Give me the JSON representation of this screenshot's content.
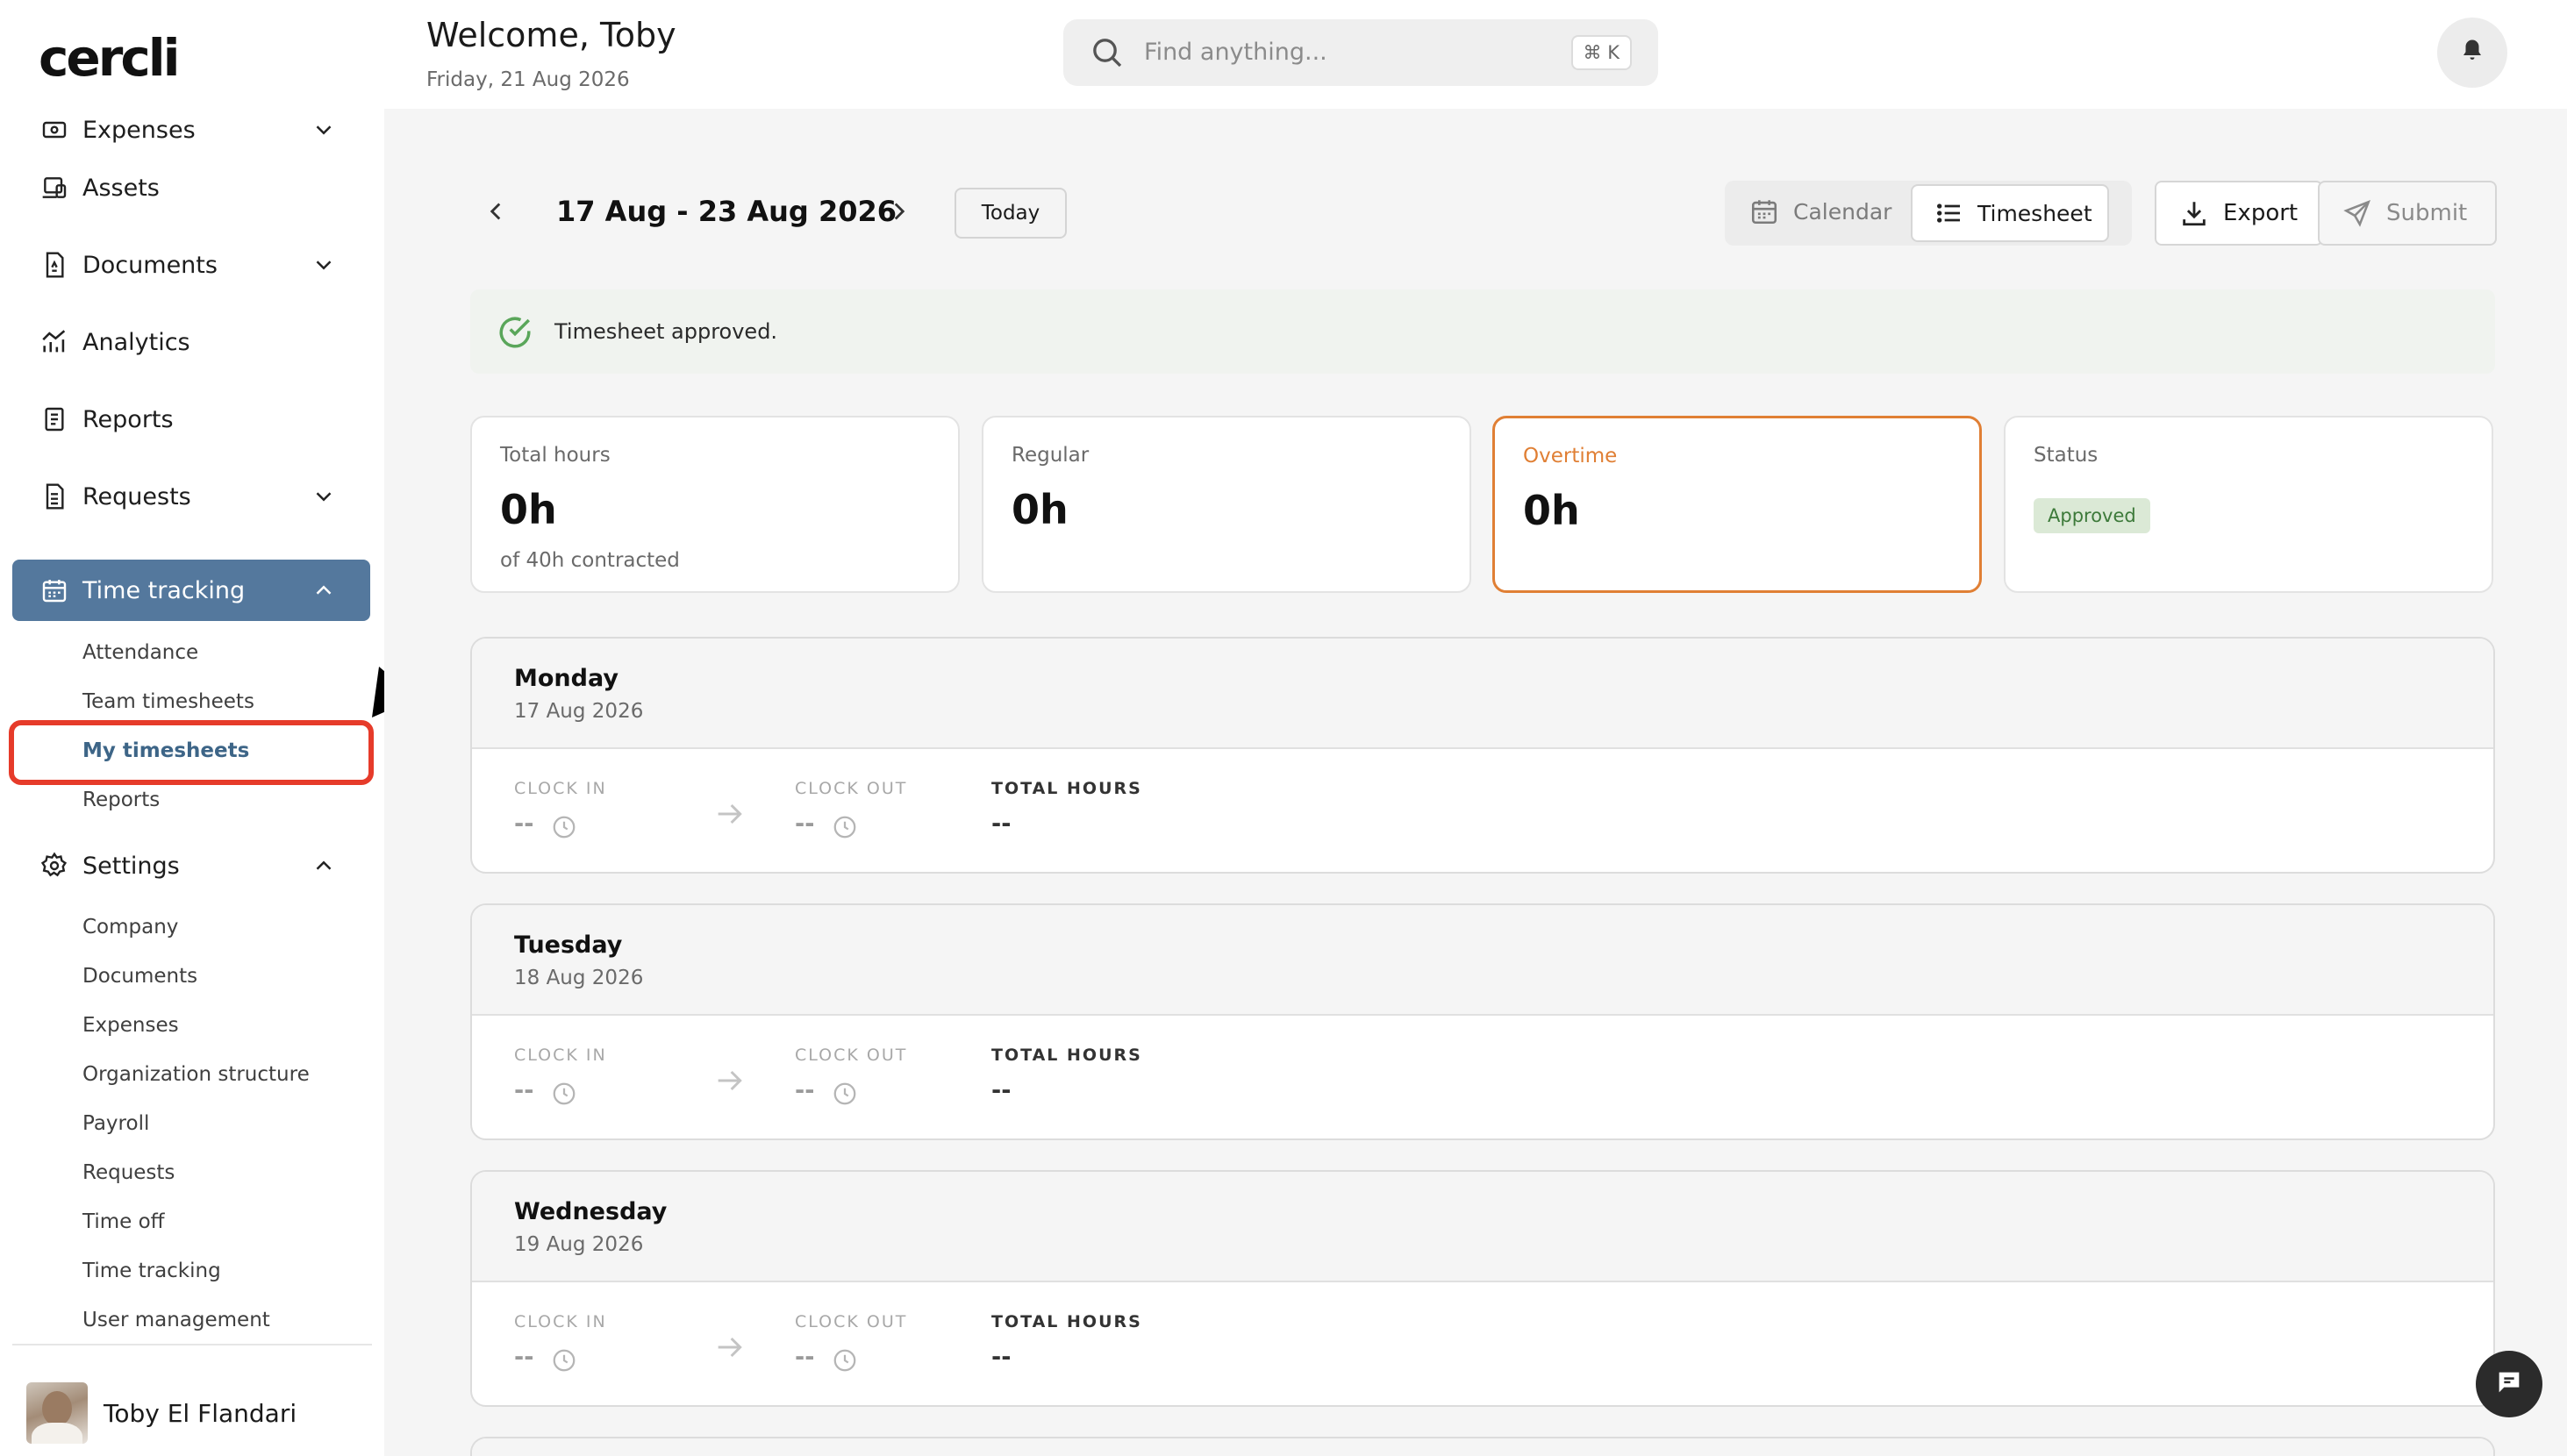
{
  "app": {
    "logo_text": "cercli"
  },
  "header": {
    "welcome": "Welcome, Toby",
    "date": "Friday, 21 Aug 2026",
    "search_placeholder": "Find anything...",
    "search_shortcut": "⌘ K"
  },
  "sidebar": {
    "items": [
      {
        "label": "Expenses",
        "icon": "receipt-icon",
        "expandable": true,
        "expanded": false
      },
      {
        "label": "Assets",
        "icon": "laptop-icon",
        "expandable": false
      },
      {
        "label": "Documents",
        "icon": "document-icon",
        "expandable": true,
        "expanded": false
      },
      {
        "label": "Analytics",
        "icon": "analytics-icon",
        "expandable": false
      },
      {
        "label": "Reports",
        "icon": "report-icon",
        "expandable": false
      },
      {
        "label": "Requests",
        "icon": "requests-icon",
        "expandable": true,
        "expanded": false
      },
      {
        "label": "Time tracking",
        "icon": "calendar-icon",
        "expandable": true,
        "expanded": true,
        "active": true
      },
      {
        "label": "Settings",
        "icon": "gear-icon",
        "expandable": true,
        "expanded": true
      }
    ],
    "time_tracking_sub": [
      "Attendance",
      "Team timesheets",
      "My timesheets",
      "Reports"
    ],
    "time_tracking_selected": "My timesheets",
    "settings_sub": [
      "Company",
      "Documents",
      "Expenses",
      "Organization structure",
      "Payroll",
      "Requests",
      "Time off",
      "Time tracking",
      "User management"
    ],
    "user_name": "Toby El Flandari"
  },
  "toolbar": {
    "week_range": "17 Aug - 23 Aug 2026",
    "today_label": "Today",
    "calendar_label": "Calendar",
    "timesheet_label": "Timesheet",
    "export_label": "Export",
    "submit_label": "Submit"
  },
  "alert": {
    "text": "Timesheet approved."
  },
  "stats": {
    "total": {
      "label": "Total hours",
      "value": "0h",
      "sub": "of 40h contracted"
    },
    "regular": {
      "label": "Regular",
      "value": "0h"
    },
    "overtime": {
      "label": "Overtime",
      "value": "0h"
    },
    "status": {
      "label": "Status",
      "badge": "Approved"
    }
  },
  "columns": {
    "clock_in": "CLOCK IN",
    "clock_out": "CLOCK OUT",
    "total_hours": "TOTAL HOURS"
  },
  "days": [
    {
      "name": "Monday",
      "date": "17 Aug 2026",
      "clock_in": "--",
      "clock_out": "--",
      "total": "--"
    },
    {
      "name": "Tuesday",
      "date": "18 Aug 2026",
      "clock_in": "--",
      "clock_out": "--",
      "total": "--"
    },
    {
      "name": "Wednesday",
      "date": "19 Aug 2026",
      "clock_in": "--",
      "clock_out": "--",
      "total": "--"
    }
  ],
  "colors": {
    "active_nav": "#54789d",
    "overtime": "#e07f34",
    "approved_bg": "#dbe9d6",
    "approved_text": "#3d7a3a",
    "highlight": "#e63b2a"
  }
}
